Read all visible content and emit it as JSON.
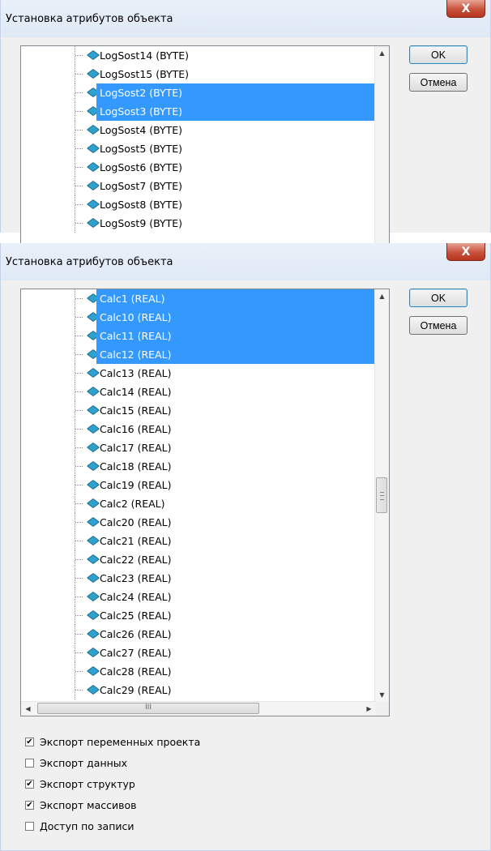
{
  "dialog1": {
    "title": "Установка атрибутов объекта",
    "close_label": "X",
    "ok_label": "OK",
    "cancel_label": "Отмена",
    "items": [
      {
        "label": "LogSost14 (BYTE)",
        "selected": false
      },
      {
        "label": "LogSost15 (BYTE)",
        "selected": false
      },
      {
        "label": "LogSost2 (BYTE)",
        "selected": true
      },
      {
        "label": "LogSost3 (BYTE)",
        "selected": true
      },
      {
        "label": "LogSost4 (BYTE)",
        "selected": false
      },
      {
        "label": "LogSost5 (BYTE)",
        "selected": false
      },
      {
        "label": "LogSost6 (BYTE)",
        "selected": false
      },
      {
        "label": "LogSost7 (BYTE)",
        "selected": false
      },
      {
        "label": "LogSost8 (BYTE)",
        "selected": false
      },
      {
        "label": "LogSost9 (BYTE)",
        "selected": false
      }
    ]
  },
  "dialog2": {
    "title": "Установка атрибутов объекта",
    "close_label": "X",
    "ok_label": "OK",
    "cancel_label": "Отмена",
    "hscroll_grip": "III",
    "items": [
      {
        "label": "Calc1 (REAL)",
        "selected": true
      },
      {
        "label": "Calc10 (REAL)",
        "selected": true
      },
      {
        "label": "Calc11 (REAL)",
        "selected": true
      },
      {
        "label": "Calc12 (REAL)",
        "selected": true
      },
      {
        "label": "Calc13 (REAL)",
        "selected": false
      },
      {
        "label": "Calc14 (REAL)",
        "selected": false
      },
      {
        "label": "Calc15 (REAL)",
        "selected": false
      },
      {
        "label": "Calc16 (REAL)",
        "selected": false
      },
      {
        "label": "Calc17 (REAL)",
        "selected": false
      },
      {
        "label": "Calc18 (REAL)",
        "selected": false
      },
      {
        "label": "Calc19 (REAL)",
        "selected": false
      },
      {
        "label": "Calc2 (REAL)",
        "selected": false
      },
      {
        "label": "Calc20 (REAL)",
        "selected": false
      },
      {
        "label": "Calc21 (REAL)",
        "selected": false
      },
      {
        "label": "Calc22 (REAL)",
        "selected": false
      },
      {
        "label": "Calc23 (REAL)",
        "selected": false
      },
      {
        "label": "Calc24 (REAL)",
        "selected": false
      },
      {
        "label": "Calc25 (REAL)",
        "selected": false
      },
      {
        "label": "Calc26 (REAL)",
        "selected": false
      },
      {
        "label": "Calc27 (REAL)",
        "selected": false
      },
      {
        "label": "Calc28 (REAL)",
        "selected": false
      },
      {
        "label": "Calc29 (REAL)",
        "selected": false
      }
    ],
    "checkboxes": [
      {
        "label": "Экспорт переменных проекта",
        "checked": true
      },
      {
        "label": "Экспорт данных",
        "checked": false
      },
      {
        "label": "Экспорт структур",
        "checked": true
      },
      {
        "label": "Экспорт массивов",
        "checked": true
      },
      {
        "label": "Доступ по записи",
        "checked": false
      }
    ]
  },
  "colors": {
    "selection": "#3399ff",
    "item_icon": "#2ea2cf",
    "close_button": "#c7513a"
  },
  "icons": {
    "item": "variable-diamond-icon",
    "close": "close-icon",
    "check": "check-mark-icon"
  }
}
